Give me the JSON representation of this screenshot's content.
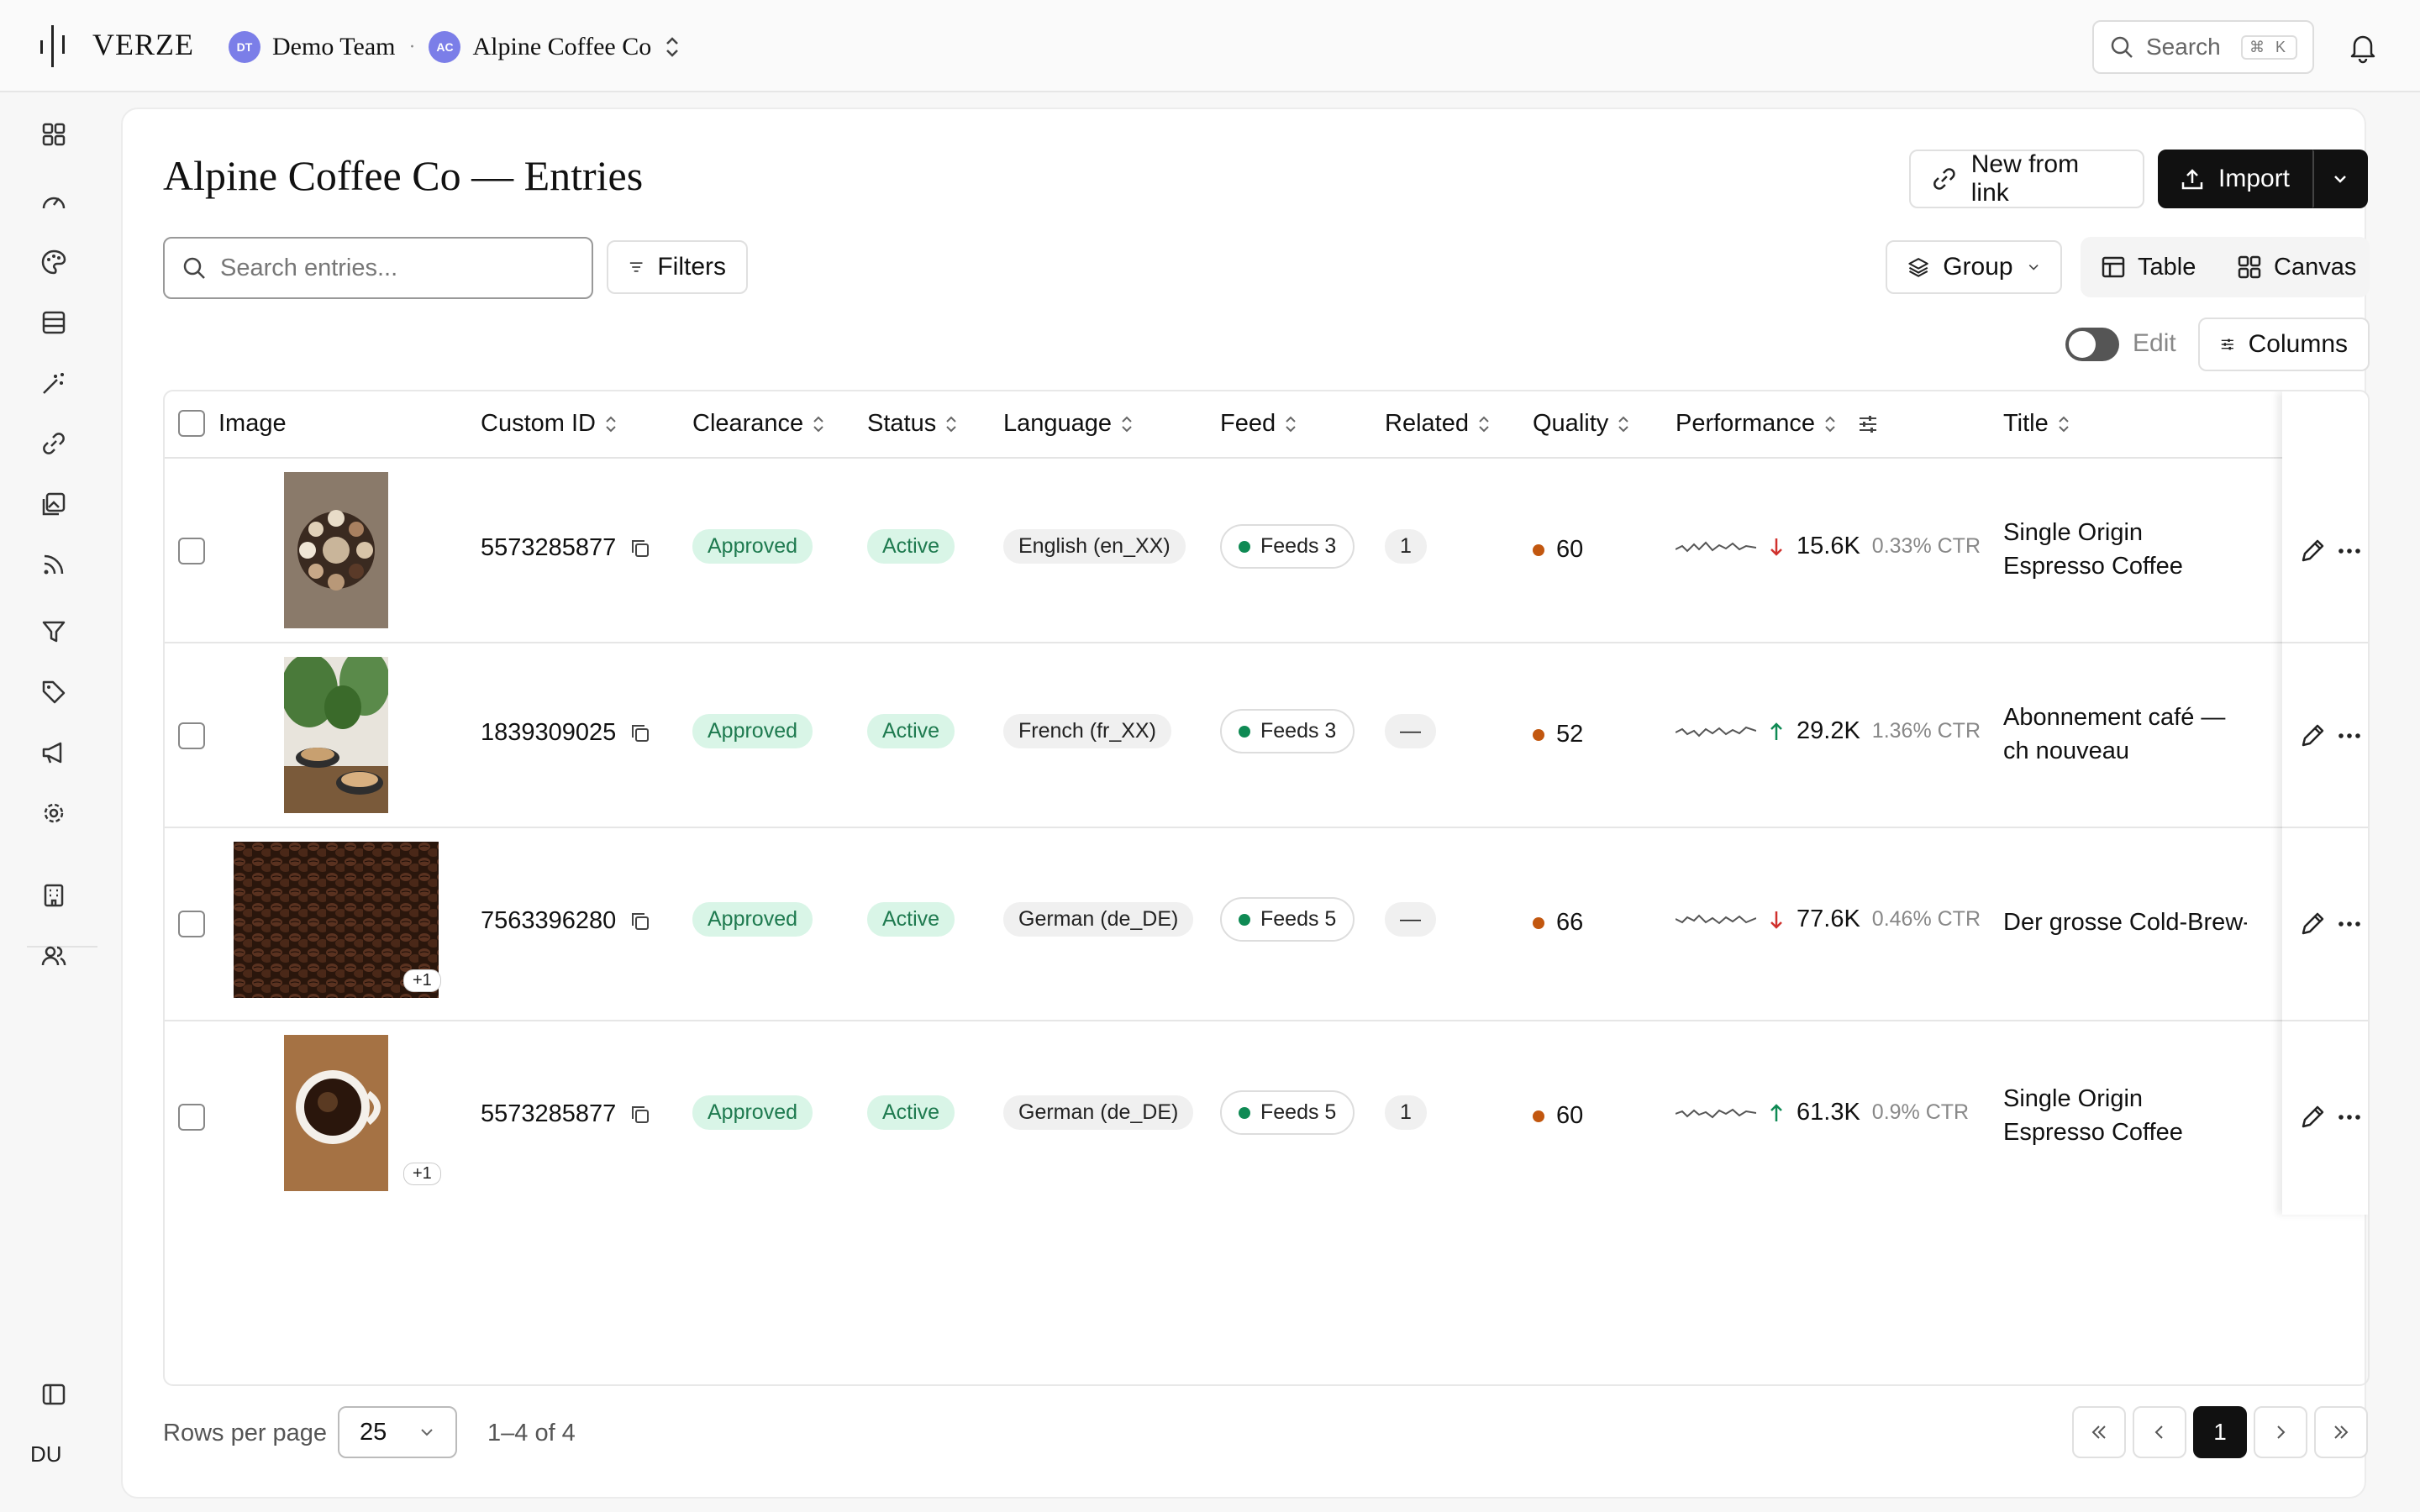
{
  "app": {
    "logo_text": "VERZE",
    "team_initials": "DT",
    "team_name": "Demo Team",
    "brand_initials": "AC",
    "brand_name": "Alpine Coffee Co",
    "search_label": "Search",
    "search_shortcut": "⌘ K",
    "user_initials": "DU"
  },
  "sidebar": {
    "items": [
      "dashboard-icon",
      "gauge-icon",
      "palette-icon",
      "table-icon",
      "magic-wand-icon",
      "link-icon",
      "images-icon",
      "feed-icon",
      "filter-icon",
      "tag-icon",
      "megaphone-icon",
      "gear-icon",
      "building-icon",
      "users-icon"
    ]
  },
  "page": {
    "title": "Alpine Coffee Co — Entries",
    "new_from_link": "New from link",
    "import": "Import",
    "search_placeholder": "Search entries...",
    "filters": "Filters",
    "group": "Group",
    "view_table": "Table",
    "view_canvas": "Canvas",
    "edit": "Edit",
    "columns": "Columns"
  },
  "table": {
    "headers": {
      "image": "Image",
      "custom_id": "Custom ID",
      "clearance": "Clearance",
      "status": "Status",
      "language": "Language",
      "feed": "Feed",
      "related": "Related",
      "quality": "Quality",
      "performance": "Performance",
      "title": "Title"
    },
    "rows": [
      {
        "custom_id": "5573285877",
        "clearance": "Approved",
        "status": "Active",
        "language": "English (en_XX)",
        "feed": "Feeds 3",
        "related": "1",
        "quality": "60",
        "trend": "down",
        "performance": "15.6K",
        "ctr": "0.33% CTR",
        "title": "Single Origin Espresso Coffee",
        "extra_images": ""
      },
      {
        "custom_id": "1839309025",
        "clearance": "Approved",
        "status": "Active",
        "language": "French (fr_XX)",
        "feed": "Feeds 3",
        "related": "—",
        "quality": "52",
        "trend": "up",
        "performance": "29.2K",
        "ctr": "1.36% CTR",
        "title": "Abonnement café — ch nouveau",
        "extra_images": ""
      },
      {
        "custom_id": "7563396280",
        "clearance": "Approved",
        "status": "Active",
        "language": "German (de_DE)",
        "feed": "Feeds 5",
        "related": "—",
        "quality": "66",
        "trend": "down",
        "performance": "77.6K",
        "ctr": "0.46% CTR",
        "title": "Der grosse Cold-Brew-",
        "extra_images": "+1"
      },
      {
        "custom_id": "5573285877",
        "clearance": "Approved",
        "status": "Active",
        "language": "German (de_DE)",
        "feed": "Feeds 5",
        "related": "1",
        "quality": "60",
        "trend": "up",
        "performance": "61.3K",
        "ctr": "0.9% CTR",
        "title": "Single Origin Espresso Coffee",
        "extra_images": "+1"
      }
    ]
  },
  "footer": {
    "rows_per_page_label": "Rows per page",
    "rows_per_page": "25",
    "range": "1–4 of 4",
    "current_page": "1"
  },
  "colors": {
    "accent_dark": "#111111",
    "approved_bg": "#d9f5e7",
    "approved_text": "#1e7a4f",
    "trend_up": "#0f8a54",
    "trend_down": "#d0312d",
    "quality_dot": "#c2570f"
  }
}
